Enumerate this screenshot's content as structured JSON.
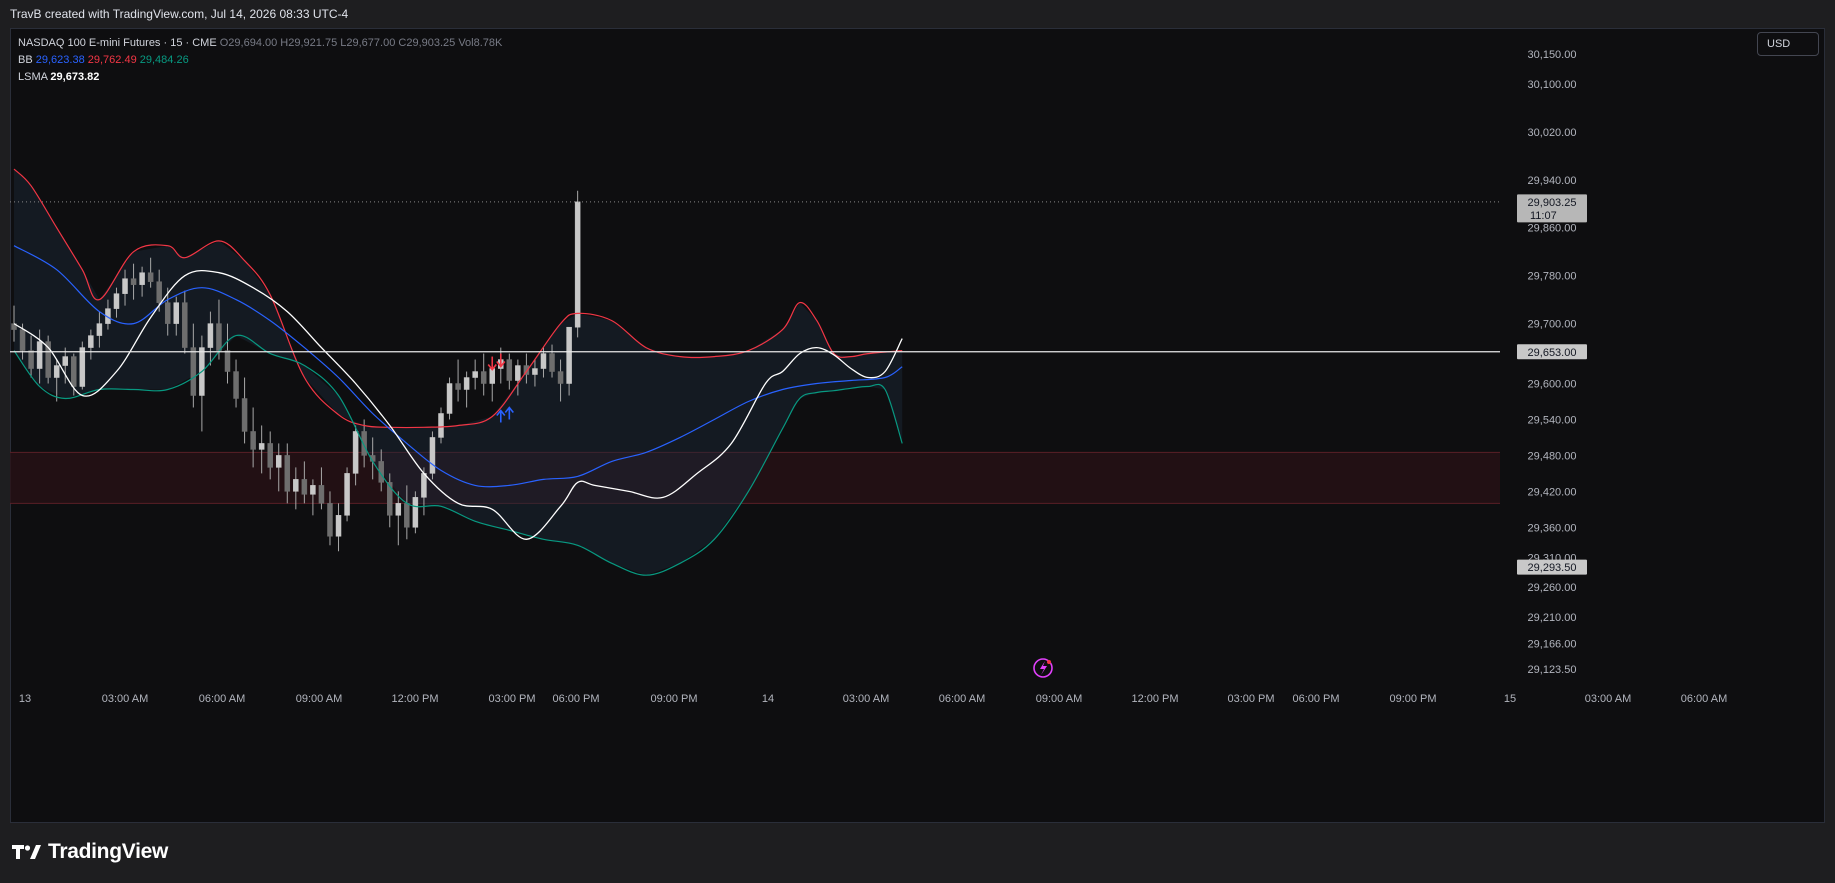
{
  "header": {
    "attribution": "TravB created with TradingView.com, Jul 14, 2026 08:33 UTC-4"
  },
  "legend": {
    "symbol": "NASDAQ 100 E-mini Futures · 15 · CME",
    "ohlc": {
      "o_label": "O",
      "o": "29,694.00",
      "h_label": "H",
      "h": "29,921.75",
      "l_label": "L",
      "l": "29,677.00",
      "c_label": "C",
      "c": "29,903.25",
      "vol_label": "Vol",
      "vol": "8.78K"
    },
    "bb": {
      "label": "BB",
      "basis": "29,623.38",
      "upper": "29,762.49",
      "lower": "29,484.26"
    },
    "lsma": {
      "label": "LSMA",
      "value": "29,673.82"
    }
  },
  "currency": "USD",
  "footer": {
    "brand": "TradingView"
  },
  "colors": {
    "background": "#0e0e10",
    "bb_basis": "#2962ff",
    "bb_upper": "#f23645",
    "bb_lower": "#089981",
    "lsma": "#ffffff",
    "candle": "#a8a8a8",
    "zone": "#2a1216",
    "signal_down": "#f23645",
    "signal_up": "#2962ff",
    "flash_icon": "#e040fb"
  },
  "chart_data": {
    "type": "line",
    "x_ticks": [
      "13",
      "03:00 AM",
      "06:00 AM",
      "09:00 AM",
      "12:00 PM",
      "03:00 PM",
      "06:00 PM",
      "09:00 PM",
      "14",
      "03:00 AM",
      "06:00 AM",
      "09:00 AM",
      "12:00 PM",
      "03:00 PM",
      "06:00 PM",
      "09:00 PM",
      "15",
      "03:00 AM",
      "06:00 AM"
    ],
    "y_ticks": [
      "30,150.00",
      "30,100.00",
      "30,020.00",
      "29,940.00",
      "29,860.00",
      "29,780.00",
      "29,700.00",
      "29,600.00",
      "29,540.00",
      "29,480.00",
      "29,420.00",
      "29,360.00",
      "29,310.00",
      "29,260.00",
      "29,210.00",
      "29,166.00",
      "29,123.50"
    ],
    "y_tick_values": [
      30150,
      30100,
      30020,
      29940,
      29860,
      29780,
      29700,
      29600,
      29540,
      29480,
      29420,
      29360,
      29310,
      29260,
      29210,
      29166,
      29123.5
    ],
    "price_labels": [
      {
        "price": "29,903.25",
        "countdown": "11:07",
        "value": 29903.25
      },
      {
        "price": "29,653.00",
        "value": 29653
      },
      {
        "price": "29,293.50",
        "value": 29293.5
      }
    ],
    "horizontal_line": 29653,
    "zone": {
      "top": 29485,
      "bottom": 29400
    },
    "series": [
      {
        "name": "BB Upper",
        "x": [
          0,
          2,
          5,
          8,
          10,
          14,
          18,
          20,
          24,
          27,
          30,
          34,
          38,
          41,
          44,
          48,
          52,
          56,
          60,
          64,
          66,
          70,
          74,
          78,
          82,
          86,
          90,
          92,
          94,
          96,
          98,
          100,
          104
        ],
        "values": [
          29958,
          29930,
          29860,
          29790,
          29740,
          29820,
          29830,
          29810,
          29838,
          29805,
          29748,
          29610,
          29548,
          29530,
          29527,
          29527,
          29530,
          29545,
          29620,
          29700,
          29717,
          29705,
          29660,
          29645,
          29645,
          29655,
          29690,
          29735,
          29705,
          29650,
          29645,
          29650,
          29655
        ]
      },
      {
        "name": "BB Basis",
        "x": [
          0,
          5,
          10,
          14,
          18,
          22,
          26,
          30,
          34,
          38,
          42,
          46,
          50,
          54,
          58,
          62,
          66,
          70,
          74,
          78,
          82,
          86,
          90,
          94,
          98,
          102,
          104
        ],
        "values": [
          29830,
          29790,
          29720,
          29700,
          29740,
          29760,
          29740,
          29705,
          29660,
          29610,
          29550,
          29500,
          29455,
          29430,
          29430,
          29440,
          29445,
          29470,
          29485,
          29510,
          29540,
          29570,
          29590,
          29600,
          29605,
          29610,
          29628
        ]
      },
      {
        "name": "BB Lower",
        "x": [
          0,
          3,
          6,
          10,
          14,
          18,
          22,
          26,
          30,
          34,
          38,
          42,
          46,
          50,
          54,
          58,
          62,
          66,
          70,
          74,
          78,
          82,
          86,
          90,
          92,
          94,
          96,
          98,
          100,
          102,
          104
        ],
        "values": [
          29655,
          29595,
          29575,
          29590,
          29590,
          29590,
          29620,
          29680,
          29650,
          29630,
          29580,
          29470,
          29400,
          29395,
          29370,
          29355,
          29340,
          29330,
          29300,
          29280,
          29300,
          29340,
          29420,
          29525,
          29575,
          29585,
          29588,
          29592,
          29595,
          29590,
          29500
        ]
      },
      {
        "name": "LSMA",
        "x": [
          0,
          4,
          8,
          12,
          16,
          20,
          24,
          28,
          32,
          36,
          40,
          44,
          48,
          52,
          56,
          60,
          64,
          66,
          68,
          72,
          76,
          80,
          84,
          88,
          90,
          92,
          94,
          96,
          98,
          100,
          102,
          104
        ],
        "values": [
          29700,
          29660,
          29580,
          29620,
          29710,
          29780,
          29785,
          29760,
          29720,
          29660,
          29600,
          29530,
          29450,
          29400,
          29390,
          29340,
          29395,
          29435,
          29430,
          29420,
          29410,
          29450,
          29500,
          29600,
          29620,
          29650,
          29660,
          29648,
          29625,
          29610,
          29620,
          29675
        ]
      }
    ],
    "candles": [
      [
        29700,
        29730,
        29670,
        29690
      ],
      [
        29690,
        29700,
        29640,
        29655
      ],
      [
        29655,
        29680,
        29610,
        29625
      ],
      [
        29625,
        29690,
        29600,
        29670
      ],
      [
        29670,
        29680,
        29600,
        29610
      ],
      [
        29610,
        29640,
        29570,
        29630
      ],
      [
        29630,
        29660,
        29600,
        29645
      ],
      [
        29645,
        29650,
        29580,
        29595
      ],
      [
        29595,
        29670,
        29590,
        29660
      ],
      [
        29660,
        29690,
        29640,
        29680
      ],
      [
        29680,
        29720,
        29660,
        29700
      ],
      [
        29700,
        29740,
        29690,
        29725
      ],
      [
        29725,
        29760,
        29710,
        29750
      ],
      [
        29750,
        29790,
        29730,
        29775
      ],
      [
        29775,
        29800,
        29740,
        29765
      ],
      [
        29765,
        29795,
        29745,
        29785
      ],
      [
        29785,
        29810,
        29760,
        29770
      ],
      [
        29770,
        29790,
        29720,
        29735
      ],
      [
        29735,
        29760,
        29680,
        29700
      ],
      [
        29700,
        29745,
        29680,
        29735
      ],
      [
        29735,
        29755,
        29650,
        29660
      ],
      [
        29660,
        29700,
        29560,
        29580
      ],
      [
        29580,
        29680,
        29520,
        29660
      ],
      [
        29660,
        29720,
        29630,
        29700
      ],
      [
        29700,
        29740,
        29640,
        29655
      ],
      [
        29655,
        29700,
        29600,
        29620
      ],
      [
        29620,
        29640,
        29560,
        29575
      ],
      [
        29575,
        29610,
        29500,
        29520
      ],
      [
        29520,
        29560,
        29460,
        29490
      ],
      [
        29490,
        29530,
        29450,
        29500
      ],
      [
        29500,
        29520,
        29440,
        29460
      ],
      [
        29460,
        29500,
        29420,
        29480
      ],
      [
        29480,
        29500,
        29400,
        29420
      ],
      [
        29420,
        29460,
        29390,
        29440
      ],
      [
        29440,
        29470,
        29400,
        29415
      ],
      [
        29415,
        29440,
        29380,
        29430
      ],
      [
        29430,
        29460,
        29390,
        29400
      ],
      [
        29400,
        29420,
        29330,
        29345
      ],
      [
        29345,
        29400,
        29320,
        29380
      ],
      [
        29380,
        29460,
        29370,
        29450
      ],
      [
        29450,
        29530,
        29430,
        29520
      ],
      [
        29520,
        29540,
        29460,
        29480
      ],
      [
        29480,
        29510,
        29440,
        29470
      ],
      [
        29470,
        29490,
        29420,
        29435
      ],
      [
        29435,
        29450,
        29360,
        29380
      ],
      [
        29380,
        29420,
        29330,
        29400
      ],
      [
        29400,
        29430,
        29340,
        29360
      ],
      [
        29360,
        29420,
        29350,
        29410
      ],
      [
        29410,
        29460,
        29380,
        29450
      ],
      [
        29450,
        29520,
        29440,
        29510
      ],
      [
        29510,
        29560,
        29500,
        29550
      ],
      [
        29550,
        29610,
        29540,
        29600
      ],
      [
        29600,
        29640,
        29570,
        29590
      ],
      [
        29590,
        29620,
        29560,
        29610
      ],
      [
        29610,
        29640,
        29590,
        29620
      ],
      [
        29620,
        29650,
        29580,
        29600
      ],
      [
        29600,
        29630,
        29570,
        29625
      ],
      [
        29625,
        29660,
        29600,
        29640
      ],
      [
        29640,
        29650,
        29590,
        29605
      ],
      [
        29605,
        29640,
        29580,
        29630
      ],
      [
        29630,
        29650,
        29600,
        29615
      ],
      [
        29615,
        29640,
        29595,
        29625
      ],
      [
        29625,
        29660,
        29610,
        29650
      ],
      [
        29650,
        29665,
        29610,
        29620
      ],
      [
        29620,
        29640,
        29570,
        29600
      ],
      [
        29600,
        29690,
        29580,
        29694
      ],
      [
        29694,
        29921.75,
        29677,
        29903.25
      ]
    ],
    "signals": [
      {
        "type": "down",
        "index": 56,
        "value": 29645
      },
      {
        "type": "down",
        "index": 57,
        "value": 29650
      },
      {
        "type": "up",
        "index": 57,
        "value": 29555
      },
      {
        "type": "up",
        "index": 58,
        "value": 29560
      }
    ]
  }
}
